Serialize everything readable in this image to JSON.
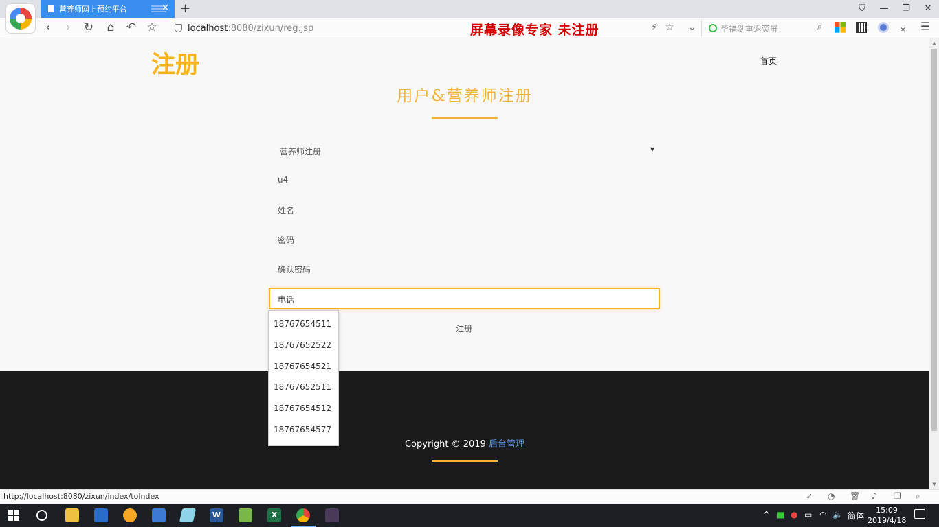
{
  "browser": {
    "tab_title": "营养师网上预约平台",
    "url_host": "localhost",
    "url_rest": ":8080/zixun/reg.jsp",
    "watermark": "屏幕录像专家  未注册",
    "search_placeholder": "毕福剑重返荧屏",
    "status_url": "http://localhost:8080/zixun/index/toIndex"
  },
  "header": {
    "site_title": "注册",
    "home_link": "首页"
  },
  "form": {
    "heading": "用户&营养师注册",
    "role_select": "营养师注册",
    "username": "u4",
    "name_placeholder": "姓名",
    "password_placeholder": "密码",
    "confirm_placeholder": "确认密码",
    "phone_placeholder": "电话",
    "submit_label": "注册",
    "autocomplete": [
      "18767654511",
      "18767652522",
      "18767654521",
      "18767652511",
      "18767654512",
      "18767654577"
    ]
  },
  "footer": {
    "copyright": "Copyright © 2019 ",
    "admin_link": "后台管理"
  },
  "taskbar": {
    "ime": "简体",
    "time": "15:09",
    "date": "2019/4/18"
  },
  "colors": {
    "accent": "#f7b21c",
    "heading": "#f2b33d",
    "footer_bg": "#1b1b1b",
    "tab_active": "#3a8ef0",
    "watermark": "#d40000"
  }
}
